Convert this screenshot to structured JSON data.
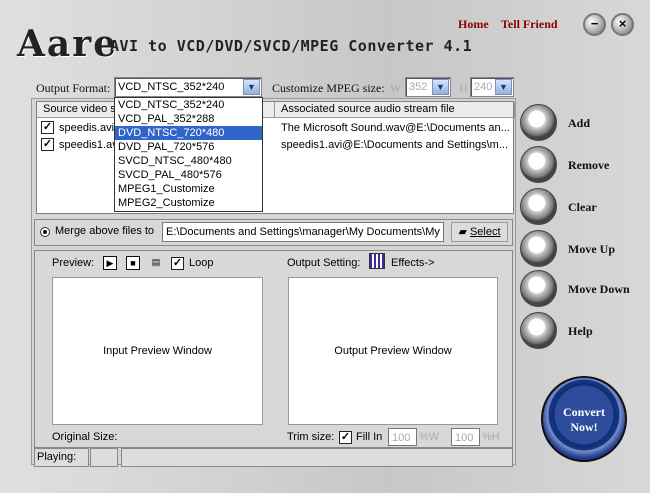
{
  "header": {
    "logo": "Aare",
    "title": "AVI to VCD/DVD/SVCD/MPEG Converter 4.1",
    "home": "Home",
    "tell_friend": "Tell Friend",
    "minimize": "−",
    "close": "×"
  },
  "format": {
    "label": "Output Format:",
    "selected": "VCD_NTSC_352*240",
    "customize_label": "Customize MPEG size:",
    "w_label": "W",
    "w_value": "352",
    "h_label": "H",
    "h_value": "240"
  },
  "dropdown": {
    "options": [
      "VCD_NTSC_352*240",
      "VCD_PAL_352*288",
      "DVD_NTSC_720*480",
      "DVD_PAL_720*576",
      "SVCD_NTSC_480*480",
      "SVCD_PAL_480*576",
      "MPEG1_Customize",
      "MPEG2_Customize"
    ],
    "selected_index": 2
  },
  "files": {
    "columns": [
      "Source video s",
      "Associated source audio stream file"
    ],
    "rows": [
      {
        "checked": true,
        "video": "speedis.avi@",
        "audio": "The Microsoft Sound.wav@E:\\Documents an..."
      },
      {
        "checked": true,
        "video": "speedis1.av",
        "audio": "speedis1.avi@E:\\Documents and Settings\\m..."
      }
    ]
  },
  "actions": {
    "add": "Add",
    "remove": "Remove",
    "clear": "Clear",
    "move_up": "Move Up",
    "move_down": "Move Down",
    "help": "Help"
  },
  "merge": {
    "label": "Merge above files to",
    "path": "E:\\Documents and Settings\\manager\\My Documents\\My V",
    "select": "Select"
  },
  "preview": {
    "label": "Preview:",
    "loop": "Loop",
    "input_window": "Input Preview Window",
    "original_size": "Original Size:"
  },
  "output": {
    "label": "Output Setting:",
    "effects": "Effects->",
    "window": "Output Preview Window",
    "trim_label": "Trim size:",
    "fill_in": "Fill In",
    "w_value": "100",
    "w_unit": "%W",
    "h_value": "100",
    "h_unit": "%H"
  },
  "convert": {
    "line1": "Convert",
    "line2": "Now!"
  },
  "status": {
    "playing": "Playing:"
  }
}
